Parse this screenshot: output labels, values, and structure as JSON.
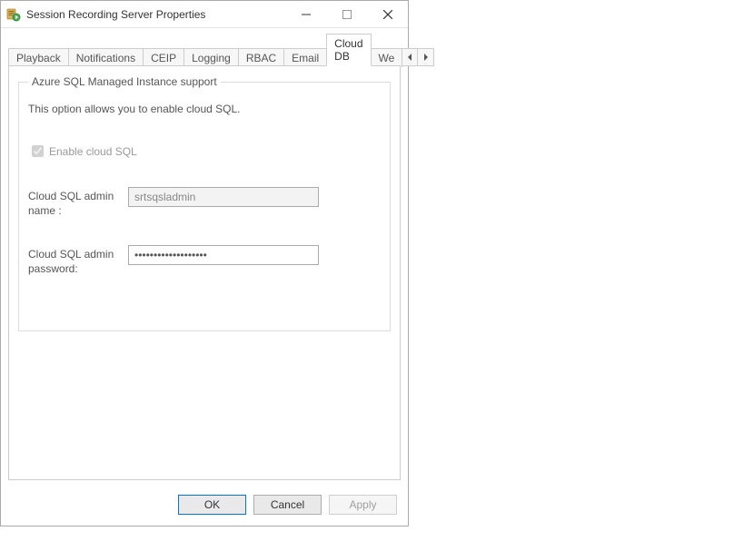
{
  "window": {
    "title": "Session Recording Server Properties"
  },
  "tabs": {
    "playback": "Playback",
    "notifications": "Notifications",
    "ceip": "CEIP",
    "logging": "Logging",
    "rbac": "RBAC",
    "email": "Email",
    "cloud_db": "Cloud DB",
    "overflow": "We"
  },
  "group": {
    "legend": "Azure SQL Managed Instance support",
    "description": "This option allows you to enable cloud SQL.",
    "enable_label": "Enable cloud SQL",
    "admin_name_label": "Cloud SQL admin name :",
    "admin_name_value": "srtsqsladmin",
    "admin_password_label": "Cloud SQL admin password:",
    "admin_password_value": "•••••••••••••••••••"
  },
  "buttons": {
    "ok": "OK",
    "cancel": "Cancel",
    "apply": "Apply"
  }
}
